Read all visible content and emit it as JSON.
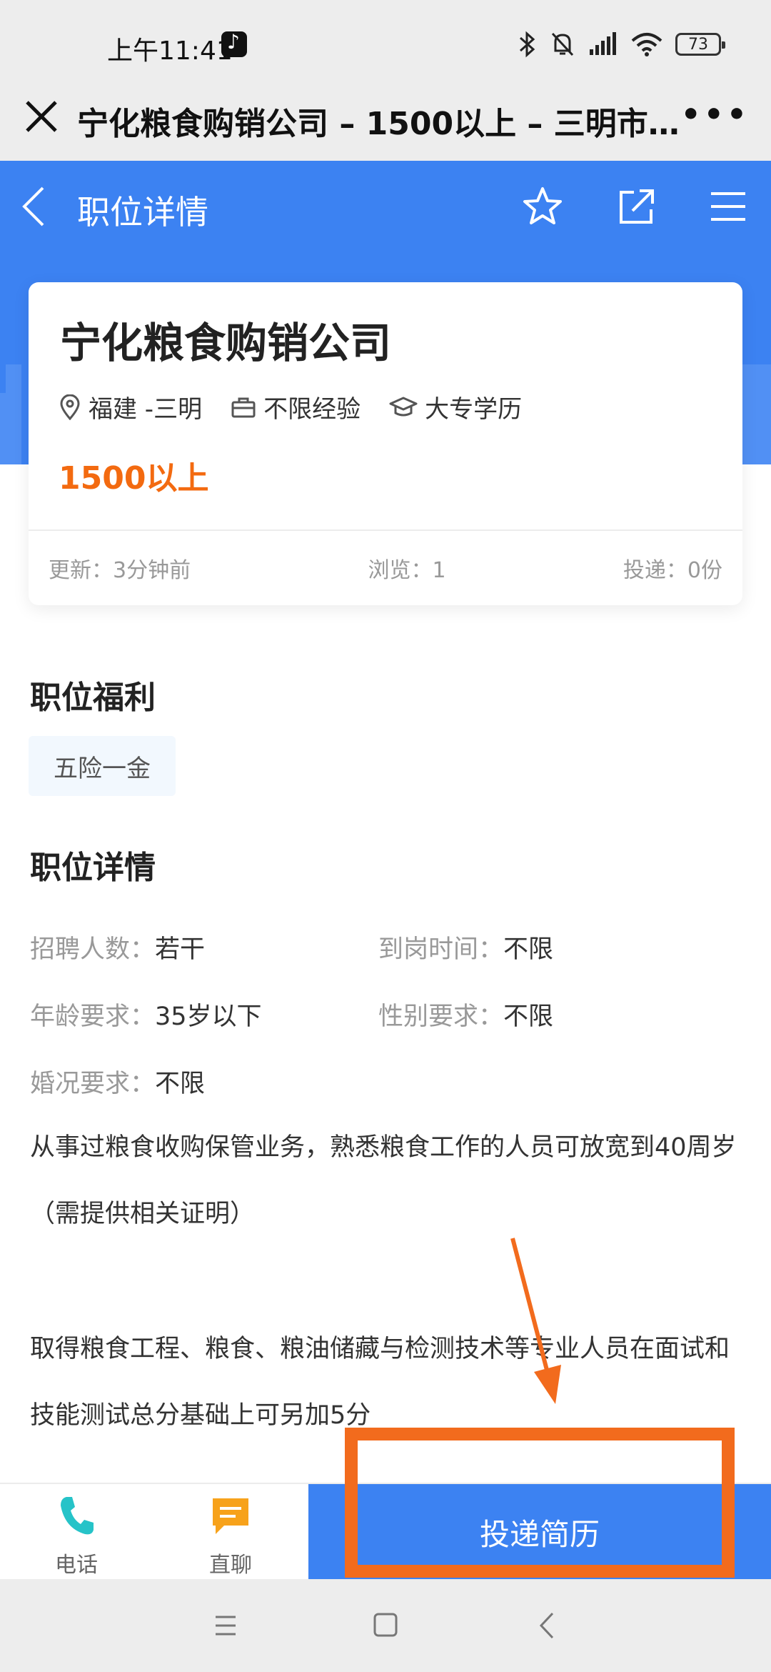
{
  "status_bar": {
    "time": "上午11:41",
    "battery": "73",
    "icons": [
      "bluetooth-icon",
      "bell-mute-icon",
      "signal-icon",
      "wifi-icon",
      "battery-icon"
    ]
  },
  "browser_bar": {
    "title": "宁化粮食购销公司 – 1500以上 – 三明市…",
    "more": "•••"
  },
  "header": {
    "title": "职位详情",
    "color": "#3c82f2"
  },
  "job": {
    "company": "宁化粮食购销公司",
    "location": "福建 -三明",
    "experience": "不限经验",
    "education": "大专学历",
    "salary": "1500以上",
    "updated": "更新：3分钟前",
    "views": "浏览：1",
    "applications": "投递：0份"
  },
  "benefits": {
    "title": "职位福利",
    "tags": [
      "五险一金"
    ]
  },
  "details": {
    "title": "职位详情",
    "fields": [
      {
        "label": "招聘人数：",
        "value": "若干"
      },
      {
        "label": "到岗时间：",
        "value": "不限"
      },
      {
        "label": "年龄要求：",
        "value": "35岁以下"
      },
      {
        "label": "性别要求：",
        "value": "不限"
      },
      {
        "label": "婚况要求：",
        "value": "不限"
      }
    ],
    "paragraph1": "从事过粮食收购保管业务，熟悉粮食工作的人员可放宽到40周岁（需提供相关证明）",
    "paragraph2": "取得粮食工程、粮食、粮油储藏与检测技术等专业人员在面试和技能测试总分基础上可另加5分"
  },
  "bottom_bar": {
    "phone_label": "电话",
    "chat_label": "直聊",
    "apply_label": "投递简历"
  },
  "colors": {
    "accent": "#3c82f2",
    "salary": "#f36a10",
    "annotation": "#f26b1d",
    "phone_icon": "#26c3c8",
    "chat_icon": "#f7a21b"
  }
}
